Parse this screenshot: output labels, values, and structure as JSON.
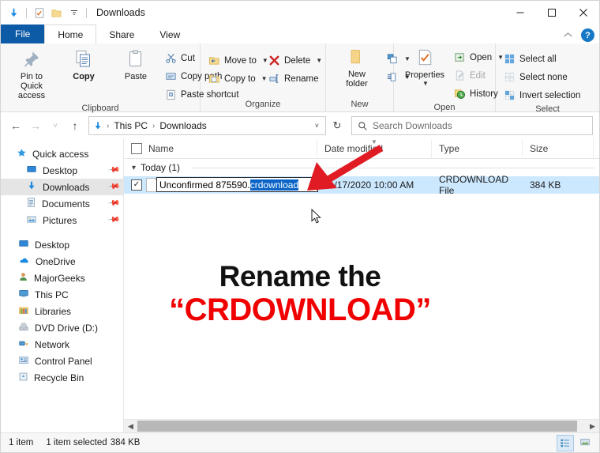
{
  "window": {
    "title": "Downloads",
    "quick_access_toolbar": [
      {
        "name": "downloads-arrow-icon",
        "label": "Downloads"
      },
      {
        "name": "properties-icon",
        "label": "Properties"
      },
      {
        "name": "new-folder-icon",
        "label": "New folder"
      },
      {
        "name": "customize-chevron-icon",
        "label": "Customize Quick Access Toolbar"
      }
    ],
    "controls": {
      "minimize": "–",
      "maximize": "☐",
      "close": "✕",
      "collapse_ribbon": "˄",
      "help": "?"
    }
  },
  "tabs": [
    {
      "label": "File",
      "active": false,
      "kind": "file"
    },
    {
      "label": "Home",
      "active": true,
      "kind": "normal"
    },
    {
      "label": "Share",
      "active": false,
      "kind": "normal"
    },
    {
      "label": "View",
      "active": false,
      "kind": "normal"
    }
  ],
  "ribbon": {
    "groups": [
      {
        "label": "Clipboard",
        "big_buttons": [
          {
            "label": "Pin to Quick\naccess",
            "line1": "Pin to Quick",
            "line2": "access",
            "icon": "pin-icon"
          },
          {
            "label": "Copy",
            "line1": "Copy",
            "line2": "",
            "icon": "copy-icon"
          },
          {
            "label": "Paste",
            "line1": "Paste",
            "line2": "",
            "icon": "paste-icon"
          }
        ],
        "small_buttons": [
          {
            "label": "Cut",
            "icon": "scissors-icon",
            "disabled": false,
            "caret": false
          },
          {
            "label": "Copy path",
            "icon": "copy-path-icon",
            "disabled": false,
            "caret": false
          },
          {
            "label": "Paste shortcut",
            "icon": "paste-shortcut-icon",
            "disabled": false,
            "caret": false
          }
        ]
      },
      {
        "label": "Organize",
        "big_buttons": [],
        "small_buttons": [
          {
            "label": "Move to",
            "icon": "move-to-icon",
            "disabled": false,
            "caret": true
          },
          {
            "label": "Copy to",
            "icon": "copy-to-icon",
            "disabled": false,
            "caret": true
          },
          {
            "label": "Delete",
            "icon": "delete-x-icon",
            "disabled": false,
            "caret": true
          },
          {
            "label": "Rename",
            "icon": "rename-icon",
            "disabled": false,
            "caret": false
          }
        ]
      },
      {
        "label": "New",
        "big_buttons": [
          {
            "label": "New folder",
            "line1": "New",
            "line2": "folder",
            "icon": "new-folder-icon"
          }
        ],
        "small_buttons": [
          {
            "label": "",
            "icon": "new-item-icon",
            "disabled": false,
            "caret": true
          },
          {
            "label": "",
            "icon": "easy-access-icon",
            "disabled": false,
            "caret": true
          }
        ]
      },
      {
        "label": "Open",
        "big_buttons": [
          {
            "label": "Properties",
            "line1": "Properties",
            "line2": "",
            "icon": "properties-icon"
          }
        ],
        "small_buttons": [
          {
            "label": "Open",
            "icon": "open-icon",
            "disabled": false,
            "caret": true
          },
          {
            "label": "Edit",
            "icon": "edit-icon",
            "disabled": true,
            "caret": false
          },
          {
            "label": "History",
            "icon": "history-icon",
            "disabled": false,
            "caret": false
          }
        ]
      },
      {
        "label": "Select",
        "big_buttons": [],
        "small_buttons": [
          {
            "label": "Select all",
            "icon": "select-all-icon",
            "disabled": false,
            "caret": false
          },
          {
            "label": "Select none",
            "icon": "select-none-icon",
            "disabled": false,
            "caret": false
          },
          {
            "label": "Invert selection",
            "icon": "invert-selection-icon",
            "disabled": false,
            "caret": false
          }
        ]
      }
    ]
  },
  "navbar": {
    "back": "←",
    "forward": "→",
    "recent": "˅",
    "up": "↑",
    "breadcrumbs": [
      "This PC",
      "Downloads"
    ],
    "breadcrumb_sep": "›",
    "dropdown": "˅",
    "refresh": "↻",
    "search_placeholder": "Search Downloads",
    "search_value": ""
  },
  "sidebar": {
    "items": [
      {
        "label": "Quick access",
        "icon": "star-icon",
        "pinned": false,
        "selected": false,
        "indent": 0
      },
      {
        "label": "Desktop",
        "icon": "desktop-icon",
        "pinned": true,
        "selected": false,
        "indent": 1
      },
      {
        "label": "Downloads",
        "icon": "downloads-arrow-icon",
        "pinned": true,
        "selected": true,
        "indent": 1
      },
      {
        "label": "Documents",
        "icon": "documents-icon",
        "pinned": true,
        "selected": false,
        "indent": 1
      },
      {
        "label": "Pictures",
        "icon": "pictures-icon",
        "pinned": true,
        "selected": false,
        "indent": 1
      },
      {
        "label": "",
        "icon": "spacer",
        "pinned": false,
        "selected": false,
        "indent": 0
      },
      {
        "label": "Desktop",
        "icon": "desktop-icon",
        "pinned": false,
        "selected": false,
        "indent": 0
      },
      {
        "label": "OneDrive",
        "icon": "onedrive-cloud-icon",
        "pinned": false,
        "selected": false,
        "indent": 0
      },
      {
        "label": "MajorGeeks",
        "icon": "user-icon",
        "pinned": false,
        "selected": false,
        "indent": 0
      },
      {
        "label": "This PC",
        "icon": "this-pc-icon",
        "pinned": false,
        "selected": false,
        "indent": 0
      },
      {
        "label": "Libraries",
        "icon": "libraries-icon",
        "pinned": false,
        "selected": false,
        "indent": 0
      },
      {
        "label": "DVD Drive (D:)",
        "icon": "dvd-drive-icon",
        "pinned": false,
        "selected": false,
        "indent": 0
      },
      {
        "label": "Network",
        "icon": "network-icon",
        "pinned": false,
        "selected": false,
        "indent": 0
      },
      {
        "label": "Control Panel",
        "icon": "control-panel-icon",
        "pinned": false,
        "selected": false,
        "indent": 0
      },
      {
        "label": "Recycle Bin",
        "icon": "recycle-bin-icon",
        "pinned": false,
        "selected": false,
        "indent": 0
      }
    ]
  },
  "filelist": {
    "columns": [
      {
        "label": "Name",
        "key": "name"
      },
      {
        "label": "Date modified",
        "key": "date",
        "sorted": true
      },
      {
        "label": "Type",
        "key": "type"
      },
      {
        "label": "Size",
        "key": "size"
      }
    ],
    "group_header": "Today (1)",
    "group_chevron": "˅",
    "rows": [
      {
        "name_base": "Unconfirmed 875590.",
        "name_selected": "crdownload",
        "full_name": "Unconfirmed 875590.crdownload",
        "date": "11/17/2020 10:00 AM",
        "type": "CRDOWNLOAD File",
        "size": "384 KB",
        "checked": true,
        "renaming": true
      }
    ]
  },
  "statusbar": {
    "item_count": "1 item",
    "selected_info": "1 item selected",
    "selected_size": "384 KB",
    "view_buttons": [
      {
        "name": "details-view-button",
        "active": true
      },
      {
        "name": "large-icons-view-button",
        "active": false
      }
    ]
  },
  "annotations": {
    "caption_line1": "Rename the",
    "caption_line2": "“CRDOWNLOAD”",
    "arrow_color": "#e01b24",
    "caption_color_1": "#111111",
    "caption_color_2": "#f00000"
  },
  "colors": {
    "accent_blue": "#0d5ba6",
    "selection_blue": "#cce8ff",
    "text_selection": "#0a64c8",
    "ribbon_bg": "#f7f7f7",
    "red": "#f00000"
  }
}
